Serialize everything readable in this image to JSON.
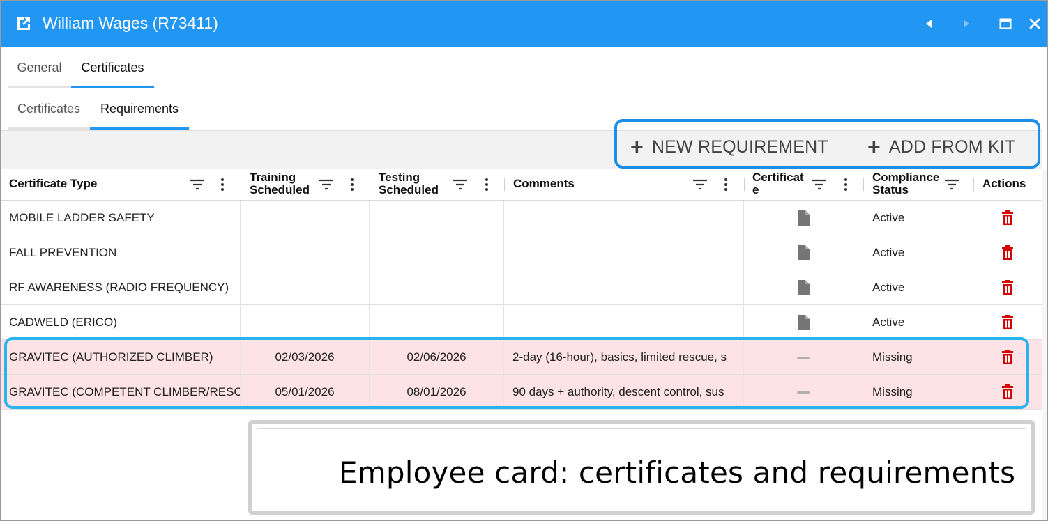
{
  "window": {
    "title": "William Wages (R73411)",
    "accent_color": "#2196f3",
    "icons": {
      "title": "open-external-icon",
      "prev": "caret-left-icon",
      "next": "caret-right-icon",
      "max": "maximize-icon",
      "close": "close-icon"
    }
  },
  "tabs": {
    "primary": [
      {
        "label": "General",
        "active": false
      },
      {
        "label": "Certificates",
        "active": true
      }
    ],
    "secondary": [
      {
        "label": "Certificates",
        "active": false
      },
      {
        "label": "Requirements",
        "active": true
      }
    ]
  },
  "toolbar": {
    "new_requirement": "NEW REQUIREMENT",
    "add_from_kit": "ADD FROM KIT",
    "plus": "+"
  },
  "grid": {
    "columns": {
      "certificate_type": "Certificate Type",
      "training_scheduled_1": "Training",
      "training_scheduled_2": "Scheduled",
      "testing_scheduled_1": "Testing",
      "testing_scheduled_2": "Scheduled",
      "comments": "Comments",
      "certificate_1": "Certificat",
      "certificate_2": "e",
      "compliance_status_1": "Compliance",
      "compliance_status_2": "Status",
      "actions": "Actions"
    },
    "rows": [
      {
        "type": "MOBILE LADDER SAFETY",
        "training": "",
        "testing": "",
        "comments": "",
        "certificate": "document-icon",
        "status": "Active"
      },
      {
        "type": "FALL PREVENTION",
        "training": "",
        "testing": "",
        "comments": "",
        "certificate": "document-icon",
        "status": "Active"
      },
      {
        "type": "RF AWARENESS (RADIO FREQUENCY)",
        "training": "",
        "testing": "",
        "comments": "",
        "certificate": "document-icon",
        "status": "Active"
      },
      {
        "type": "CADWELD (ERICO)",
        "training": "",
        "testing": "",
        "comments": "",
        "certificate": "document-icon",
        "status": "Active"
      },
      {
        "type": "GRAVITEC (AUTHORIZED CLIMBER)",
        "training": "02/03/2026",
        "testing": "02/06/2026",
        "comments": "2-day (16-hour), basics, limited rescue, s",
        "certificate": "dash",
        "status": "Missing"
      },
      {
        "type": "GRAVITEC (COMPETENT CLIMBER/RESCU",
        "training": "05/01/2026",
        "testing": "08/01/2026",
        "comments": "90 days + authority, descent control, sus",
        "certificate": "dash",
        "status": "Missing"
      }
    ],
    "missing_row_color": "#fde3e5",
    "delete_icon_color": "#d50000"
  },
  "caption": {
    "text": "Employee card: certificates and requirements"
  }
}
